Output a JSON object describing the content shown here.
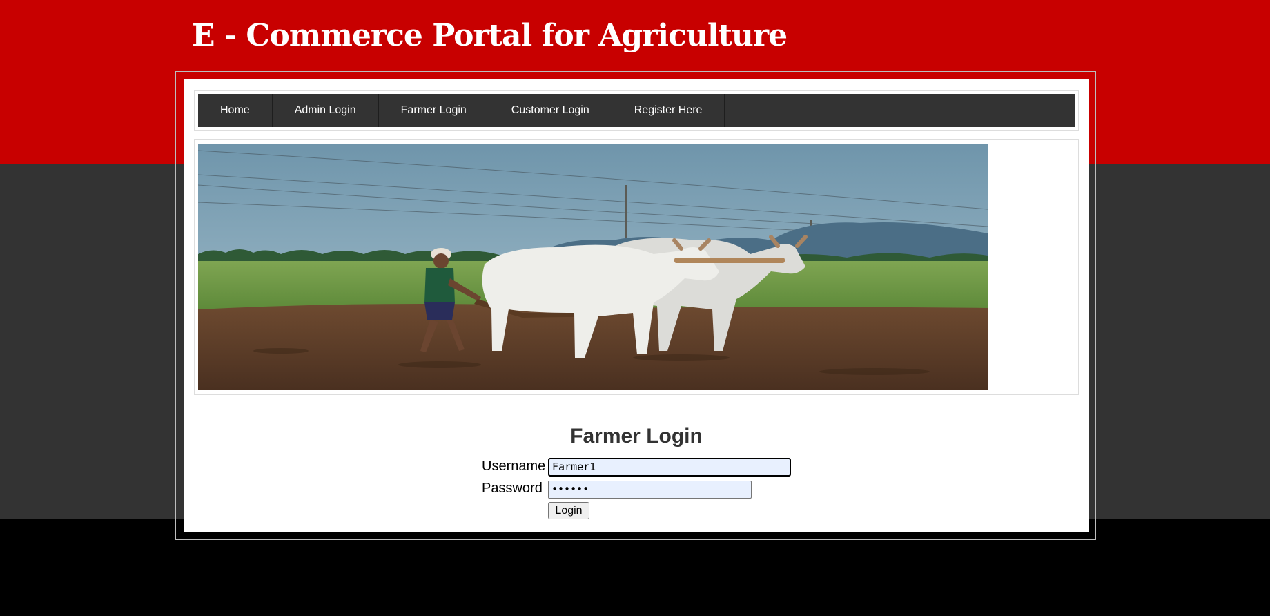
{
  "header": {
    "title": "E - Commerce Portal for Agriculture"
  },
  "nav": {
    "items": [
      {
        "label": "Home"
      },
      {
        "label": "Admin Login"
      },
      {
        "label": "Farmer Login"
      },
      {
        "label": "Customer Login"
      },
      {
        "label": "Register Here"
      }
    ]
  },
  "form": {
    "title": "Farmer Login",
    "username_label": "Username",
    "username_value": "Farmer1",
    "password_label": "Password",
    "password_value": "••••••",
    "submit_label": "Login"
  },
  "colors": {
    "header_band": "#c80000",
    "middle_band": "#333333",
    "footer_band": "#000000",
    "nav_background": "#333333"
  }
}
